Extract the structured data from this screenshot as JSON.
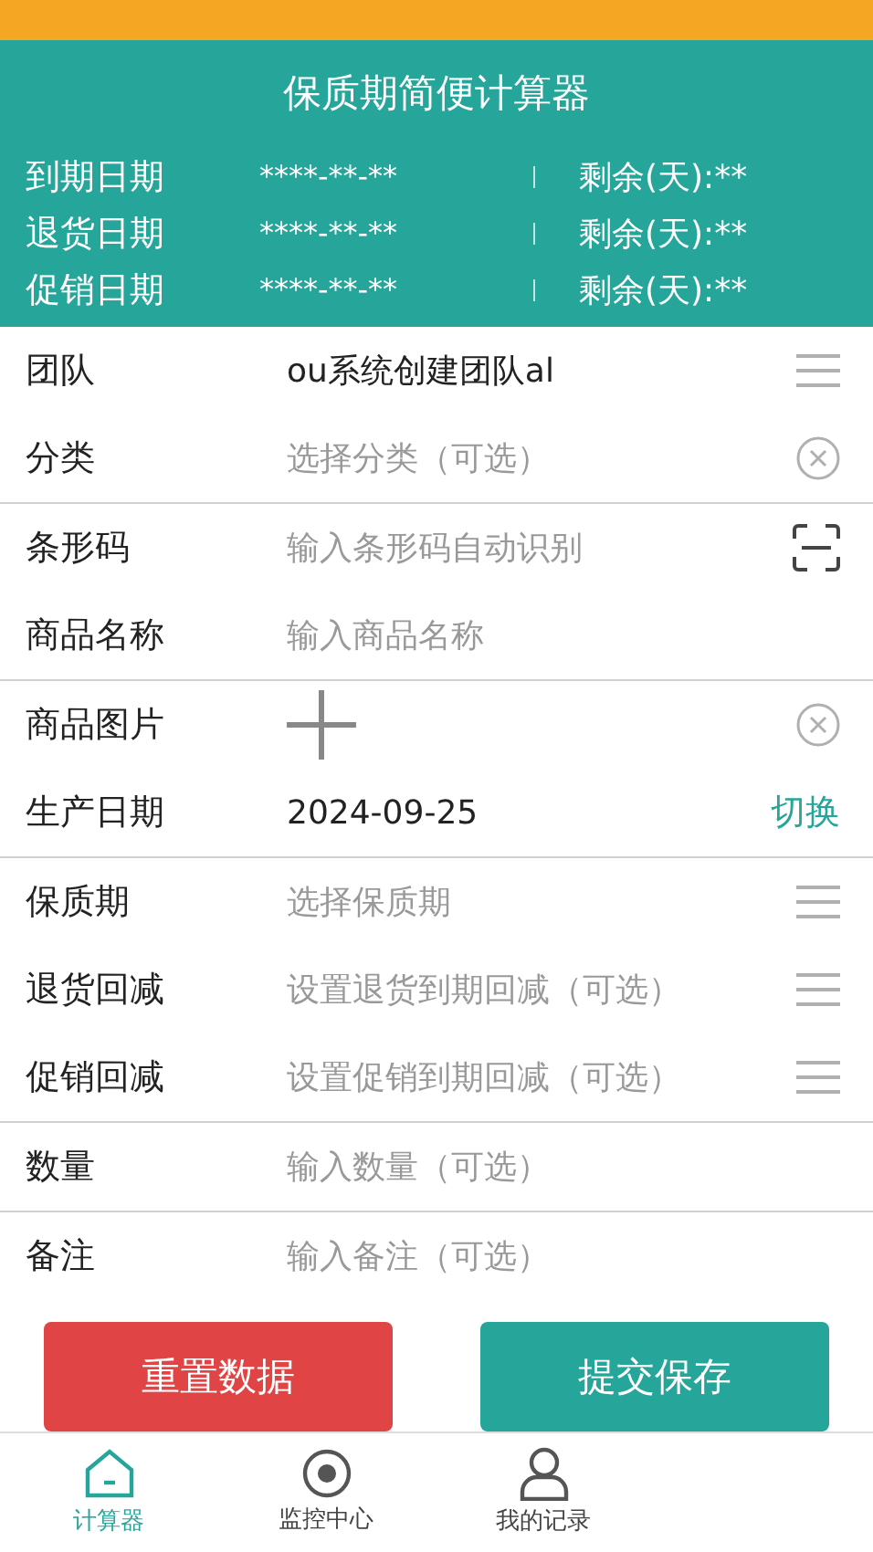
{
  "title": "保质期简便计算器",
  "dates": [
    {
      "label": "到期日期",
      "value": "****-**-**",
      "remaining": "剩余(天):**"
    },
    {
      "label": "退货日期",
      "value": "****-**-**",
      "remaining": "剩余(天):**"
    },
    {
      "label": "促销日期",
      "value": "****-**-**",
      "remaining": "剩余(天):**"
    }
  ],
  "groups": [
    [
      {
        "kind": "input",
        "label": "团队",
        "value": "ou系统创建团队al",
        "trailing": {
          "kind": "menu"
        }
      },
      {
        "kind": "input",
        "label": "分类",
        "placeholder": "选择分类（可选）",
        "trailing": {
          "kind": "clear"
        }
      }
    ],
    [
      {
        "kind": "input",
        "label": "条形码",
        "placeholder": "输入条形码自动识别",
        "trailing": {
          "kind": "scan"
        }
      },
      {
        "kind": "input",
        "label": "商品名称",
        "placeholder": "输入商品名称"
      }
    ],
    [
      {
        "kind": "image",
        "label": "商品图片",
        "trailing": {
          "kind": "clear"
        }
      },
      {
        "kind": "input",
        "label": "生产日期",
        "value": "2024-09-25",
        "trailing": {
          "kind": "link",
          "label": "切换"
        }
      }
    ],
    [
      {
        "kind": "input",
        "label": "保质期",
        "placeholder": "选择保质期",
        "trailing": {
          "kind": "menu"
        }
      },
      {
        "kind": "input",
        "label": "退货回减",
        "placeholder": "设置退货到期回减（可选）",
        "trailing": {
          "kind": "menu"
        }
      },
      {
        "kind": "input",
        "label": "促销回减",
        "placeholder": "设置促销到期回减（可选）",
        "trailing": {
          "kind": "menu"
        }
      }
    ],
    [
      {
        "kind": "input",
        "label": "数量",
        "placeholder": "输入数量（可选）"
      }
    ],
    [
      {
        "kind": "input",
        "label": "备注",
        "placeholder": "输入备注（可选）"
      }
    ]
  ],
  "buttons": [
    {
      "kind": "reset",
      "label": "重置数据"
    },
    {
      "kind": "submit",
      "label": "提交保存"
    }
  ],
  "nav": [
    {
      "kind": "home",
      "label": "计算器",
      "selected": true
    },
    {
      "kind": "monitor",
      "label": "监控中心",
      "selected": false
    },
    {
      "kind": "user",
      "label": "我的记录",
      "selected": false
    }
  ]
}
